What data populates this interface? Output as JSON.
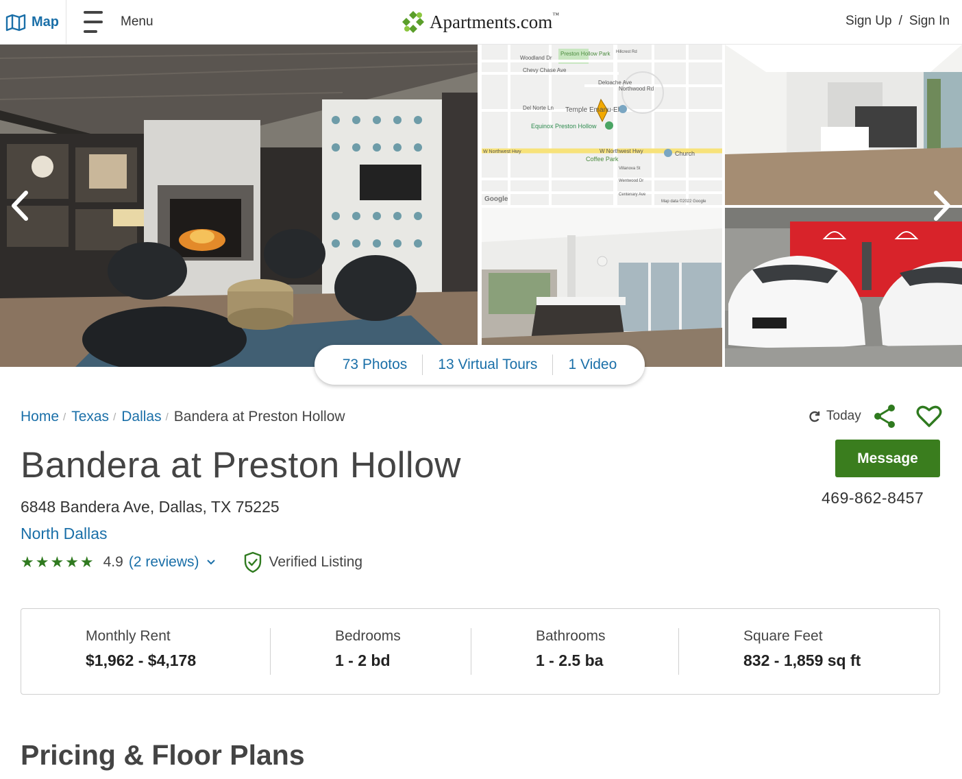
{
  "header": {
    "map_label": "Map",
    "menu_label": "Menu",
    "logo_text": "Apartments.com",
    "logo_tm": "™",
    "sign_up": "Sign Up",
    "auth_separator": "/",
    "sign_in": "Sign In"
  },
  "gallery": {
    "map": {
      "labels": [
        "Woodland Dr",
        "Preston Hollow Park",
        "Chevy Chase Ave",
        "Deloache Ave",
        "Northwood Rd",
        "Del Norte Ln",
        "Temple Emanu-El",
        "Equinox Preston Hollow",
        "W Northwest Hwy",
        "W Northwest Hwy",
        "Church",
        "Coffee Park",
        "Villanova St",
        "Wentwood Dr",
        "Centenary Ave",
        "Hillcrest Rd",
        "Google",
        "Map data ©2022 Google"
      ]
    },
    "media": [
      {
        "label": "73 Photos"
      },
      {
        "label": "13 Virtual Tours"
      },
      {
        "label": "1 Video"
      }
    ]
  },
  "breadcrumb": [
    {
      "label": "Home"
    },
    {
      "label": "Texas"
    },
    {
      "label": "Dallas"
    }
  ],
  "breadcrumb_separator": "/",
  "breadcrumb_current": "Bandera at Preston Hollow",
  "property": {
    "name": "Bandera at Preston Hollow",
    "address": "6848 Bandera Ave, Dallas, TX 75225",
    "neighborhood": "North Dallas",
    "stars_text": "★★★★★",
    "rating": "4.9",
    "reviews": "(2 reviews)",
    "verified": "Verified Listing"
  },
  "actions": {
    "updated": "Today",
    "message": "Message",
    "phone": "469-862-8457"
  },
  "facts": [
    {
      "label": "Monthly Rent",
      "value": "$1,962 - $4,178"
    },
    {
      "label": "Bedrooms",
      "value": "1 - 2 bd"
    },
    {
      "label": "Bathrooms",
      "value": "1 - 2.5 ba"
    },
    {
      "label": "Square Feet",
      "value": "832 - 1,859 sq ft"
    }
  ],
  "section_title": "Pricing & Floor Plans",
  "colors": {
    "link": "#1a6fa8",
    "primary_button": "#3a7d1e",
    "stars": "#2f7a1f"
  }
}
